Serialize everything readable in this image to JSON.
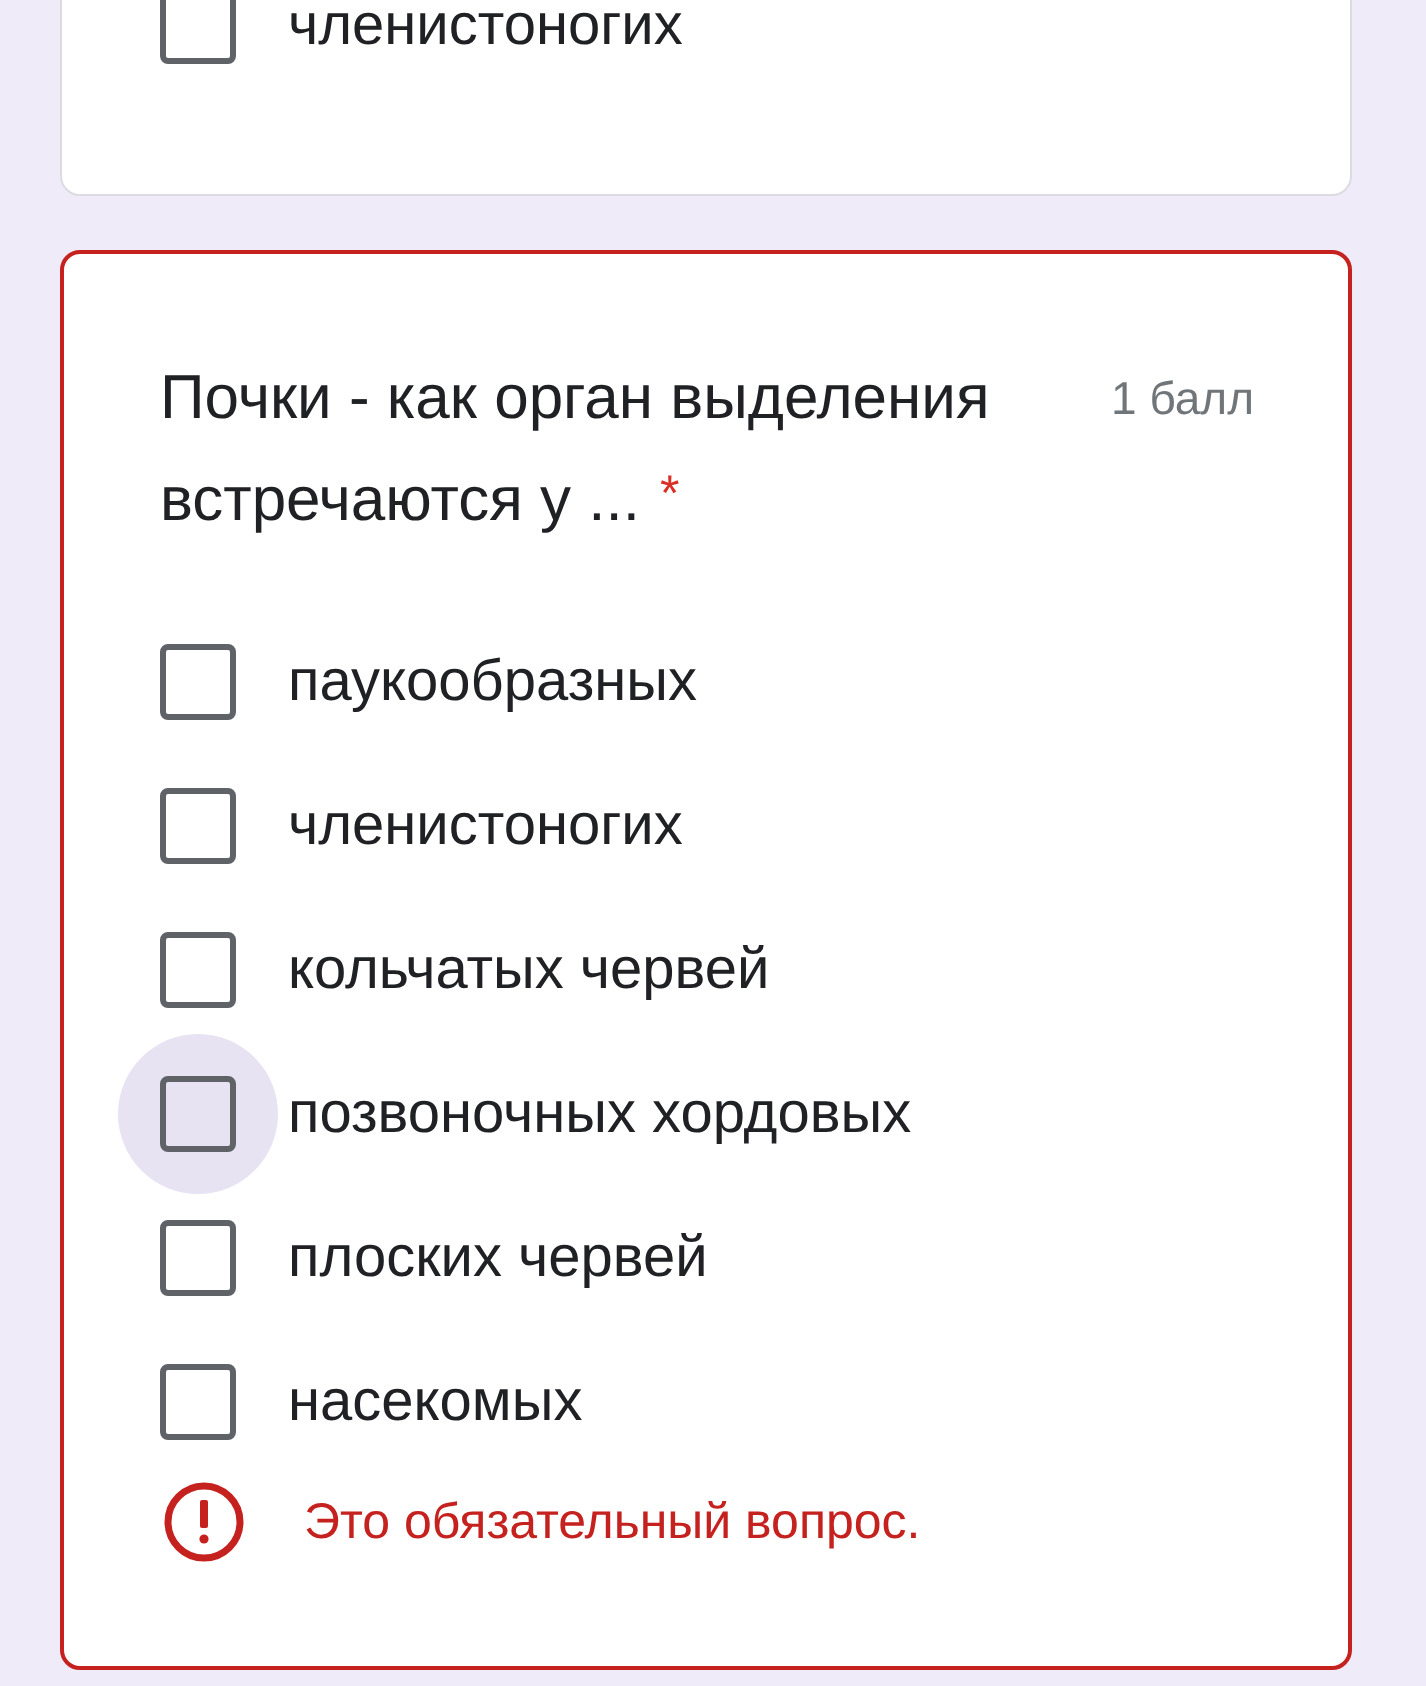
{
  "questions": [
    {
      "options": [
        {
          "label": "членистоногих",
          "checked": false,
          "hovered": false
        }
      ]
    },
    {
      "title": "Почки - как орган выделения встречаются у ...",
      "required_mark": "*",
      "points": "1 балл",
      "options": [
        {
          "label": "паукообразных",
          "checked": false,
          "hovered": false
        },
        {
          "label": "членистоногих",
          "checked": false,
          "hovered": false
        },
        {
          "label": "кольчатых червей",
          "checked": false,
          "hovered": false
        },
        {
          "label": "позвоночных хордовых",
          "checked": false,
          "hovered": true
        },
        {
          "label": "плоских червей",
          "checked": false,
          "hovered": false
        },
        {
          "label": "насекомых",
          "checked": false,
          "hovered": false
        }
      ],
      "error": "Это обязательный вопрос."
    }
  ]
}
